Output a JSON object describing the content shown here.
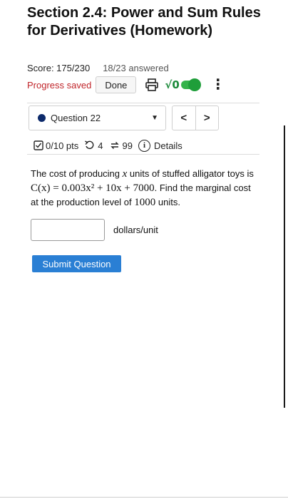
{
  "header": {
    "title": "Section 2.4: Power and Sum Rules for Derivatives (Homework)",
    "score": "Score: 175/230",
    "answered": "18/23 answered"
  },
  "status": {
    "progress": "Progress saved",
    "done_label": "Done",
    "print_icon": "printer-icon",
    "sqrt_label": "√0",
    "toggle_on": true,
    "more_icon": "⋮"
  },
  "question_nav": {
    "selected": "Question 22",
    "dot_color": "#0d2a6b",
    "prev": "<",
    "next": ">"
  },
  "meta": {
    "points": "0/10 pts",
    "retries": "4",
    "attempts": "99",
    "details": "Details"
  },
  "question": {
    "text_1": "The cost of producing ",
    "var_x": "x",
    "text_2": " units of stuffed alligator toys is ",
    "func": "C(x) = 0.003x² + 10x + 7000",
    "text_3": ". Find the marginal cost at the production level of ",
    "level": "1000",
    "text_4": " units."
  },
  "answer": {
    "value": "",
    "unit": "dollars/unit"
  },
  "submit": {
    "label": "Submit Question",
    "color": "#2a7fd4"
  }
}
